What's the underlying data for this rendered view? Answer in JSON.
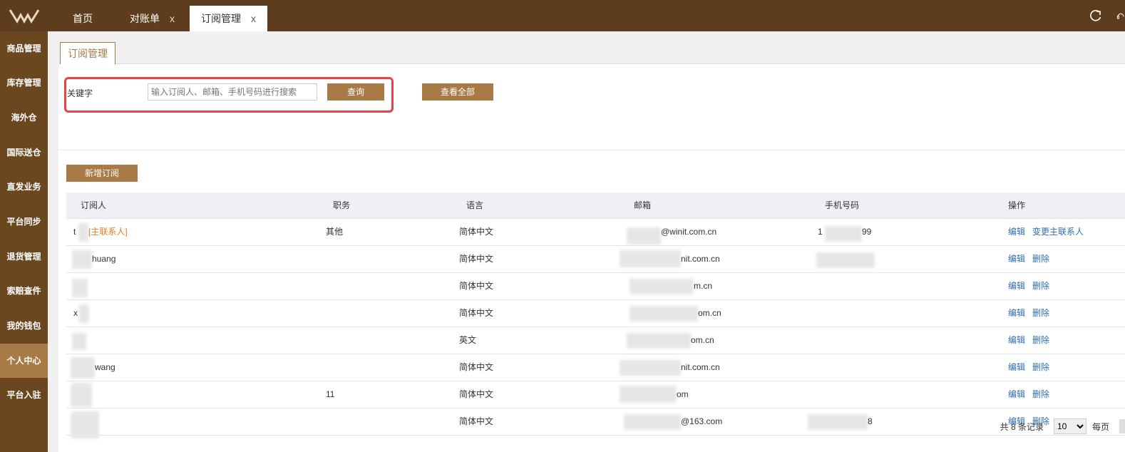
{
  "header": {
    "tabs": [
      {
        "label": "首页",
        "closable": false,
        "active": false
      },
      {
        "label": "对账单",
        "closable": true,
        "active": false
      },
      {
        "label": "订阅管理",
        "closable": true,
        "active": true
      }
    ],
    "close_glyph": "x",
    "icons": [
      "refresh-icon",
      "headset-icon"
    ]
  },
  "sidebar": {
    "items": [
      {
        "label": "商品管理"
      },
      {
        "label": "库存管理"
      },
      {
        "label": "海外仓"
      },
      {
        "label": "国际送仓"
      },
      {
        "label": "直发业务"
      },
      {
        "label": "平台同步"
      },
      {
        "label": "退货管理"
      },
      {
        "label": "索赔查件"
      },
      {
        "label": "我的钱包"
      },
      {
        "label": "个人中心",
        "active": true
      },
      {
        "label": "平台入驻"
      }
    ]
  },
  "page": {
    "tab_title": "订阅管理",
    "keyword_label": "关键字",
    "search_placeholder": "输入订阅人、邮箱、手机号码进行搜索",
    "query_button": "查询",
    "view_all_button": "查看全部",
    "add_button": "新增订阅"
  },
  "table": {
    "columns": [
      "订阅人",
      "职务",
      "语言",
      "邮箱",
      "手机号码",
      "操作"
    ],
    "rows": [
      {
        "subscriber": "t",
        "tag": "[主联系人]",
        "position": "其他",
        "language": "简体中文",
        "email": "@winit.com.cn",
        "phone": "1",
        "phone_tail": "99",
        "op1": "编辑",
        "op2": "变更主联系人"
      },
      {
        "subscriber": "huang",
        "tag": "",
        "position": "",
        "language": "简体中文",
        "email": "nit.com.cn",
        "phone": "",
        "phone_tail": "",
        "op1": "编辑",
        "op2": "删除"
      },
      {
        "subscriber": "",
        "tag": "",
        "position": "",
        "language": "简体中文",
        "email": "m.cn",
        "phone": "",
        "phone_tail": "",
        "op1": "编辑",
        "op2": "删除"
      },
      {
        "subscriber": "x",
        "tag": "",
        "position": "",
        "language": "简体中文",
        "email": "om.cn",
        "phone": "",
        "phone_tail": "",
        "op1": "编辑",
        "op2": "删除"
      },
      {
        "subscriber": "",
        "tag": "",
        "position": "",
        "language": "英文",
        "email": "om.cn",
        "phone": "",
        "phone_tail": "",
        "op1": "编辑",
        "op2": "删除"
      },
      {
        "subscriber": "wang",
        "tag": "",
        "position": "",
        "language": "简体中文",
        "email": "nit.com.cn",
        "phone": "",
        "phone_tail": "",
        "op1": "编辑",
        "op2": "删除"
      },
      {
        "subscriber": "",
        "tag": "",
        "position": "11",
        "language": "简体中文",
        "email": "om",
        "phone": "",
        "phone_tail": "",
        "op1": "编辑",
        "op2": "删除"
      },
      {
        "subscriber": "",
        "tag": "",
        "position": "",
        "language": "简体中文",
        "email": "@163.com",
        "phone": "",
        "phone_tail": "8",
        "op1": "编辑",
        "op2": "删除"
      }
    ]
  },
  "pagination": {
    "total_text": "共 8 条记录",
    "page_size": "10",
    "per_page_label": "每页"
  }
}
